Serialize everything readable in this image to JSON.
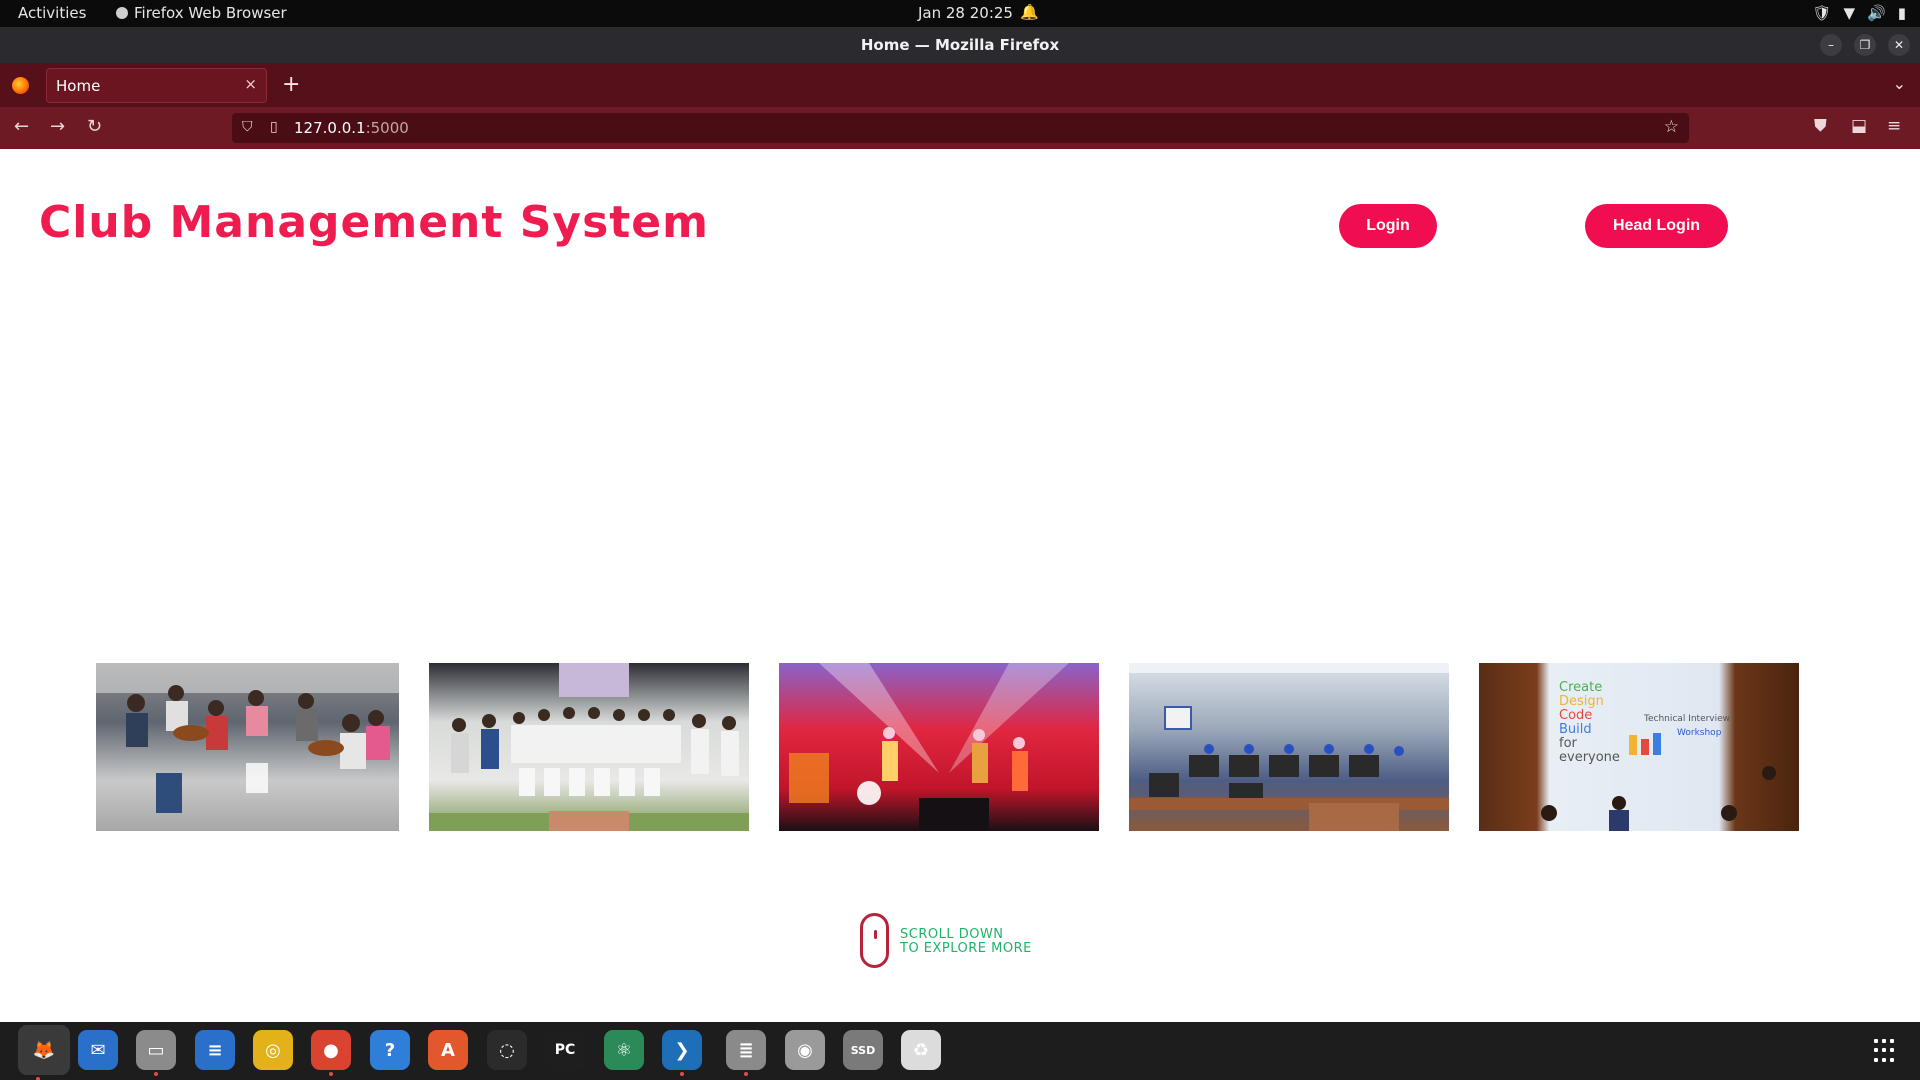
{
  "topbar": {
    "activities": "Activities",
    "app_name": "Firefox Web Browser",
    "datetime": "Jan 28  20:25"
  },
  "window": {
    "title": "Home — Mozilla Firefox"
  },
  "tabs": [
    {
      "label": "Home",
      "close": "×"
    }
  ],
  "newtab_label": "+",
  "url": {
    "host": "127.0.0.1",
    "port": ":5000"
  },
  "page": {
    "site_title": "Club Management System",
    "login_label": "Login",
    "head_login_label": "Head Login",
    "scroll_line1": "SCROLL DOWN",
    "scroll_line2": "TO EXPLORE MORE",
    "photo_5_text": {
      "line1": "Create",
      "line2": "Design",
      "line3": "Code",
      "line4": "Build",
      "line5": "for",
      "line6": "everyone",
      "side1": "Technical Interview",
      "side2": "Workshop"
    }
  },
  "colors": {
    "accent": "#f00d50",
    "title": "#ee1c4f",
    "scroll_text": "#1eb36a",
    "browser_frame": "#6d1a25"
  },
  "dock": {
    "items": [
      {
        "name": "firefox-icon",
        "glyph": "🦊",
        "bg": "#3a3a3a",
        "running": true
      },
      {
        "name": "mail-icon",
        "glyph": "✉",
        "bg": "#2a6fc9",
        "running": false
      },
      {
        "name": "files-icon",
        "glyph": "▭",
        "bg": "#8b8b8b",
        "running": true
      },
      {
        "name": "writer-icon",
        "glyph": "≡",
        "bg": "#2a6fc9",
        "running": false
      },
      {
        "name": "rhythmbox-icon",
        "glyph": "◎",
        "bg": "#e3b21a",
        "running": false
      },
      {
        "name": "chrome-icon",
        "glyph": "●",
        "bg": "#d9432f",
        "running": true
      },
      {
        "name": "help-icon",
        "glyph": "?",
        "bg": "#2f7fd9",
        "running": false
      },
      {
        "name": "software-icon",
        "glyph": "A",
        "bg": "#e3572c",
        "running": false
      },
      {
        "name": "jupyter-icon",
        "glyph": "◌",
        "bg": "#2b2b2b",
        "running": false
      },
      {
        "name": "pycharm-icon",
        "glyph": "PC",
        "bg": "#1e1e1e",
        "running": false
      },
      {
        "name": "atom-icon",
        "glyph": "⚛",
        "bg": "#2b8a57",
        "running": false
      },
      {
        "name": "vscode-icon",
        "glyph": "❯",
        "bg": "#1e6fb8",
        "running": true
      },
      {
        "name": "database-icon",
        "glyph": "≣",
        "bg": "#8a8a8a",
        "running": true
      },
      {
        "name": "disk-icon",
        "glyph": "◉",
        "bg": "#9a9a9a",
        "running": false
      },
      {
        "name": "ssd-icon",
        "glyph": "SSD",
        "bg": "#7a7a7a",
        "running": false
      },
      {
        "name": "trash-icon",
        "glyph": "♻",
        "bg": "#dcdcdc",
        "running": false
      }
    ]
  }
}
